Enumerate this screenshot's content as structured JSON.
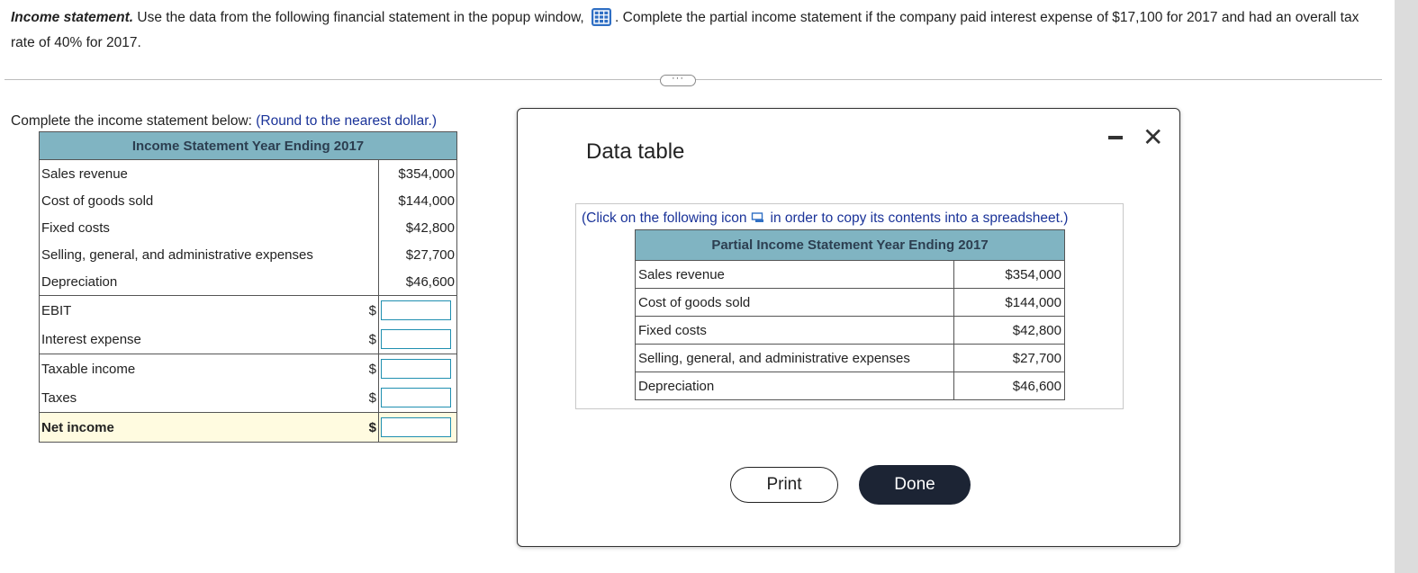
{
  "question": {
    "lead": "Income statement.",
    "text_before_icon": " Use the data from the following financial statement in the popup window, ",
    "text_after_icon": ". Complete the partial income statement if the company paid interest expense of $17,100 for 2017 and had an overall tax rate of 40% for 2017."
  },
  "expander_label": "···",
  "instruction": {
    "text": "Complete the income statement below:",
    "hint": "(Round to the nearest dollar.)"
  },
  "statement": {
    "header": "Income Statement Year Ending 2017",
    "rows": [
      {
        "label": "Sales revenue",
        "value": "$354,000"
      },
      {
        "label": "Cost of goods sold",
        "value": "$144,000"
      },
      {
        "label": "Fixed costs",
        "value": "$42,800"
      },
      {
        "label": "Selling, general, and administrative expenses",
        "value": "$27,700"
      },
      {
        "label": "Depreciation",
        "value": "$46,600"
      }
    ],
    "input_rows": [
      {
        "label": "EBIT",
        "currency": "$",
        "value": ""
      },
      {
        "label": "Interest expense",
        "currency": "$",
        "value": ""
      },
      {
        "label": "Taxable income",
        "currency": "$",
        "value": ""
      },
      {
        "label": "Taxes",
        "currency": "$",
        "value": ""
      },
      {
        "label": "Net income",
        "currency": "$",
        "value": ""
      }
    ]
  },
  "dialog": {
    "title": "Data table",
    "copy_note_before": "(Click on the following icon",
    "copy_note_after": "in order to copy its contents into a spreadsheet.)",
    "table_header": "Partial Income Statement Year Ending 2017",
    "rows": [
      {
        "label": "Sales revenue",
        "value": "$354,000"
      },
      {
        "label": "Cost of goods sold",
        "value": "$144,000"
      },
      {
        "label": "Fixed costs",
        "value": "$42,800"
      },
      {
        "label": "Selling, general, and administrative expenses",
        "value": "$27,700"
      },
      {
        "label": "Depreciation",
        "value": "$46,600"
      }
    ],
    "print_label": "Print",
    "done_label": "Done"
  }
}
